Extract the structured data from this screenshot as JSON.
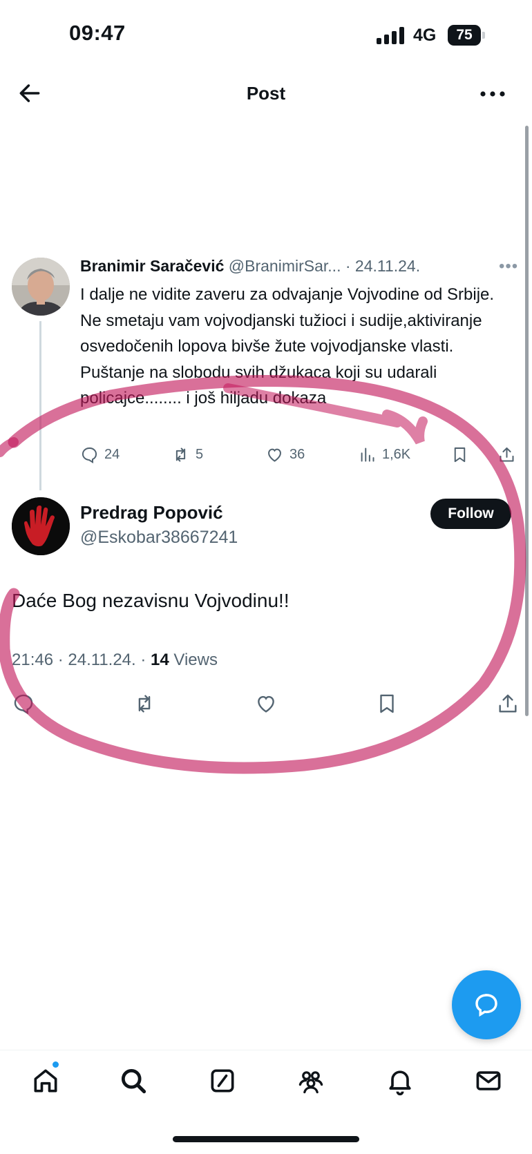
{
  "status_bar": {
    "time": "09:47",
    "network": "4G",
    "battery": "75"
  },
  "header": {
    "title": "Post",
    "back_icon": "arrow-left-icon",
    "more_icon": "more-horizontal-icon"
  },
  "quoted_tweet": {
    "author_name": "Branimir Saračević",
    "meta": "@BranimirSar... · 24.11.24.",
    "text": "I dalje ne vidite zaveru za odvajanje Vojvodine od Srbije.  Ne smetaju vam vojvodjanski tužioci i sudije,aktiviranje osvedočenih lopova bivše  žute vojvodjanske vlasti. Puštanje na slobodu svih džukaca koji su udarali policajce........ i još hiljadu dokaza",
    "replies": "24",
    "reposts": "5",
    "likes": "36",
    "views": "1,6K"
  },
  "main_tweet": {
    "author_name": "Predrag Popović",
    "handle": "@Eskobar38667241",
    "follow_label": "Follow",
    "text": "Daće Bog nezavisnu Vojvodinu!!",
    "time_date": "21:46 · 24.11.24. · ",
    "views_count": "14",
    "views_label": " Views"
  },
  "colors": {
    "accent": "#1d9bf0",
    "text": "#0f1419",
    "secondary": "#536471",
    "annotation": "#c2185b"
  },
  "bottom_nav": [
    "home-icon",
    "search-icon",
    "grok-icon",
    "communities-icon",
    "notifications-icon",
    "messages-icon"
  ]
}
